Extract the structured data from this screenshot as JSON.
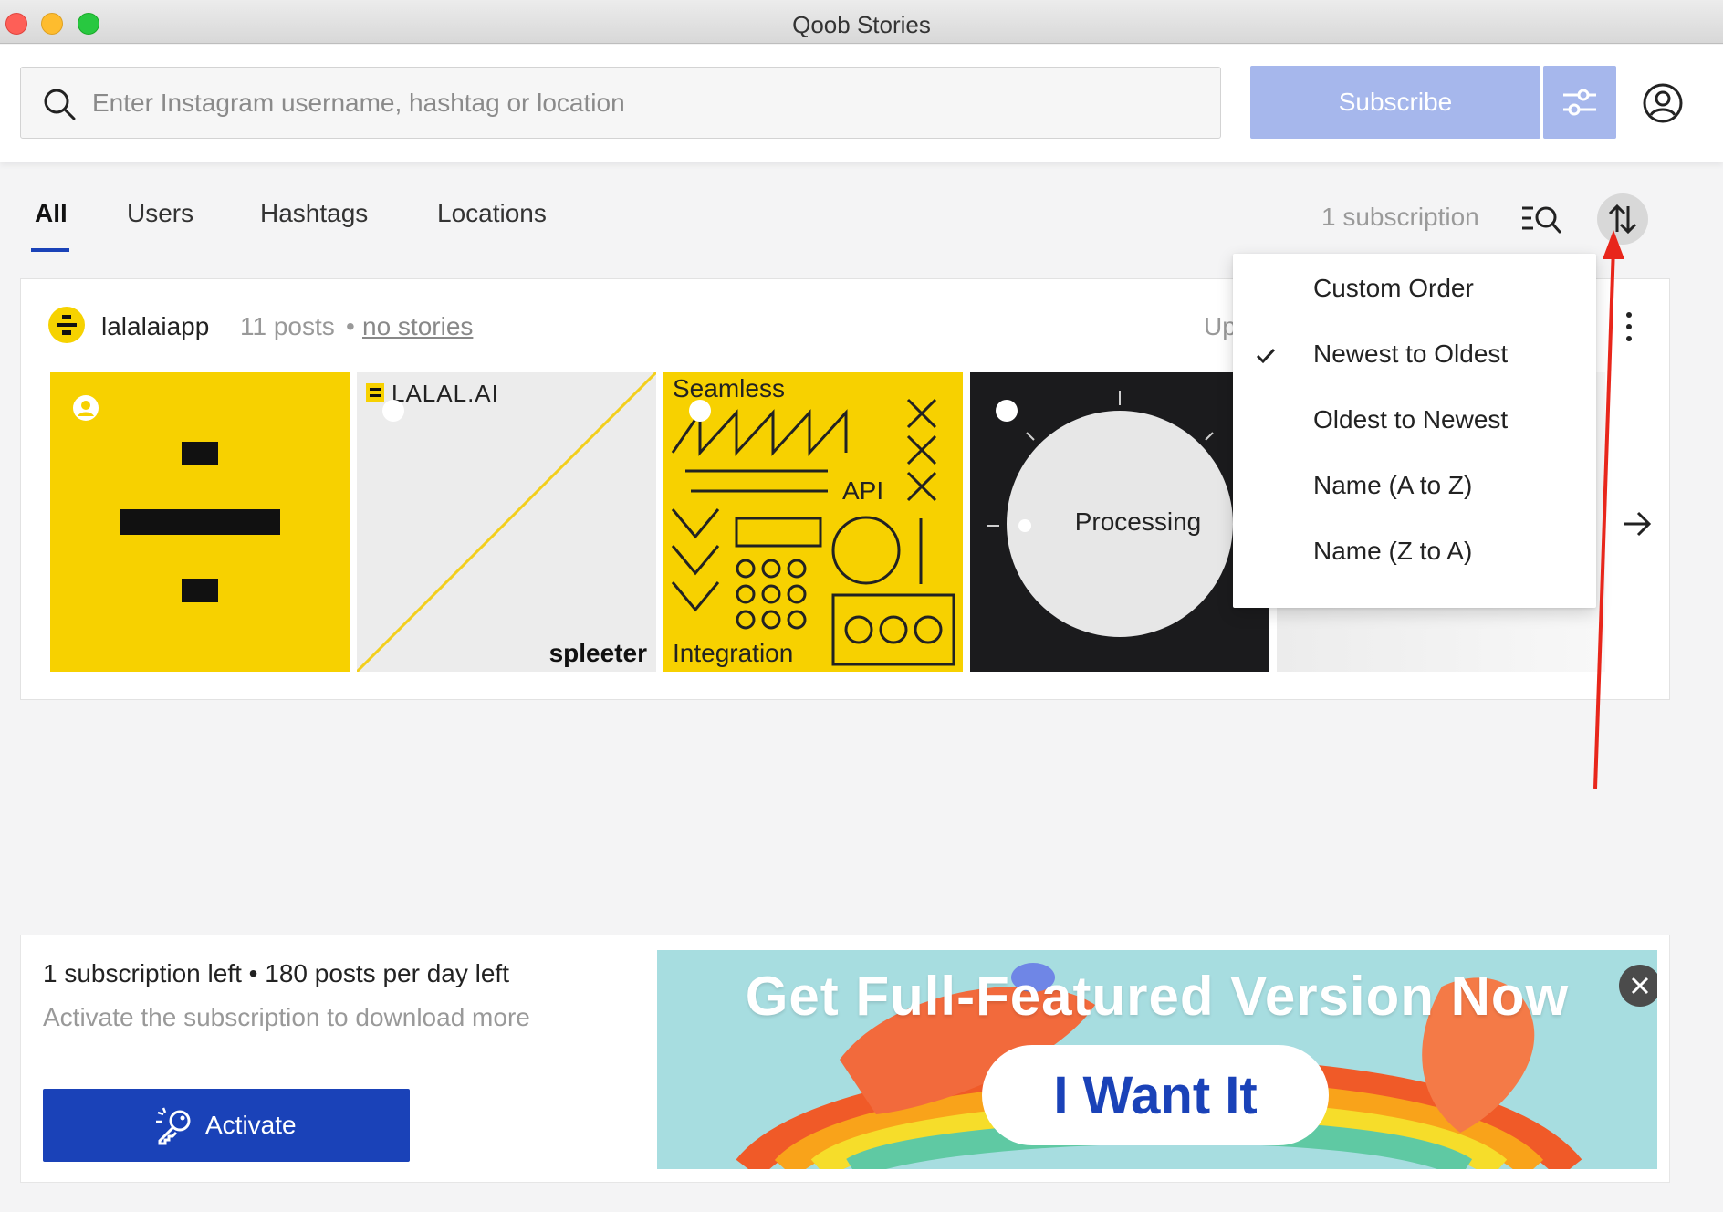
{
  "window": {
    "title": "Qoob Stories"
  },
  "search": {
    "placeholder": "Enter Instagram username, hashtag or location",
    "value": ""
  },
  "toolbar": {
    "subscribe_label": "Subscribe"
  },
  "tabs": [
    {
      "label": "All",
      "active": true
    },
    {
      "label": "Users",
      "active": false
    },
    {
      "label": "Hashtags",
      "active": false
    },
    {
      "label": "Locations",
      "active": false
    }
  ],
  "summary": {
    "subscription_count": "1 subscription"
  },
  "subscription": {
    "username": "lalalaiapp",
    "posts": "11 posts",
    "separator": "•",
    "stories": "no stories",
    "updated": "Up"
  },
  "thumbnails": {
    "t2_label": "LALAL.AI",
    "t2_brand": "spleeter",
    "t3_top": "Seamless",
    "t3_mid": "API",
    "t3_bottom": "Integration",
    "t4_label": "Processing"
  },
  "sort_menu": {
    "items": [
      {
        "label": "Custom Order",
        "checked": false
      },
      {
        "label": "Newest to Oldest",
        "checked": true
      },
      {
        "label": "Oldest to Newest",
        "checked": false
      },
      {
        "label": "Name (A to Z)",
        "checked": false
      },
      {
        "label": "Name (Z to A)",
        "checked": false
      }
    ]
  },
  "limits": {
    "text": "1 subscription left • 180 posts per day left",
    "subtext": "Activate the subscription to download more",
    "activate_label": "Activate"
  },
  "banner": {
    "title": "Get Full-Featured Version Now",
    "cta": "I Want It"
  },
  "colors": {
    "accent": "#1a42b8",
    "subscribe_disabled": "#a6b7ec",
    "brand_yellow": "#f7d100",
    "annotation_red": "#e8261b"
  },
  "icons": {
    "search": "search-icon",
    "filter": "sliders-icon",
    "account": "account-circle-icon",
    "search_list": "list-search-icon",
    "sort": "sort-arrows-icon",
    "more": "more-vertical-icon",
    "next": "arrow-right-icon",
    "check": "check-icon",
    "key": "key-icon",
    "close": "close-icon"
  }
}
